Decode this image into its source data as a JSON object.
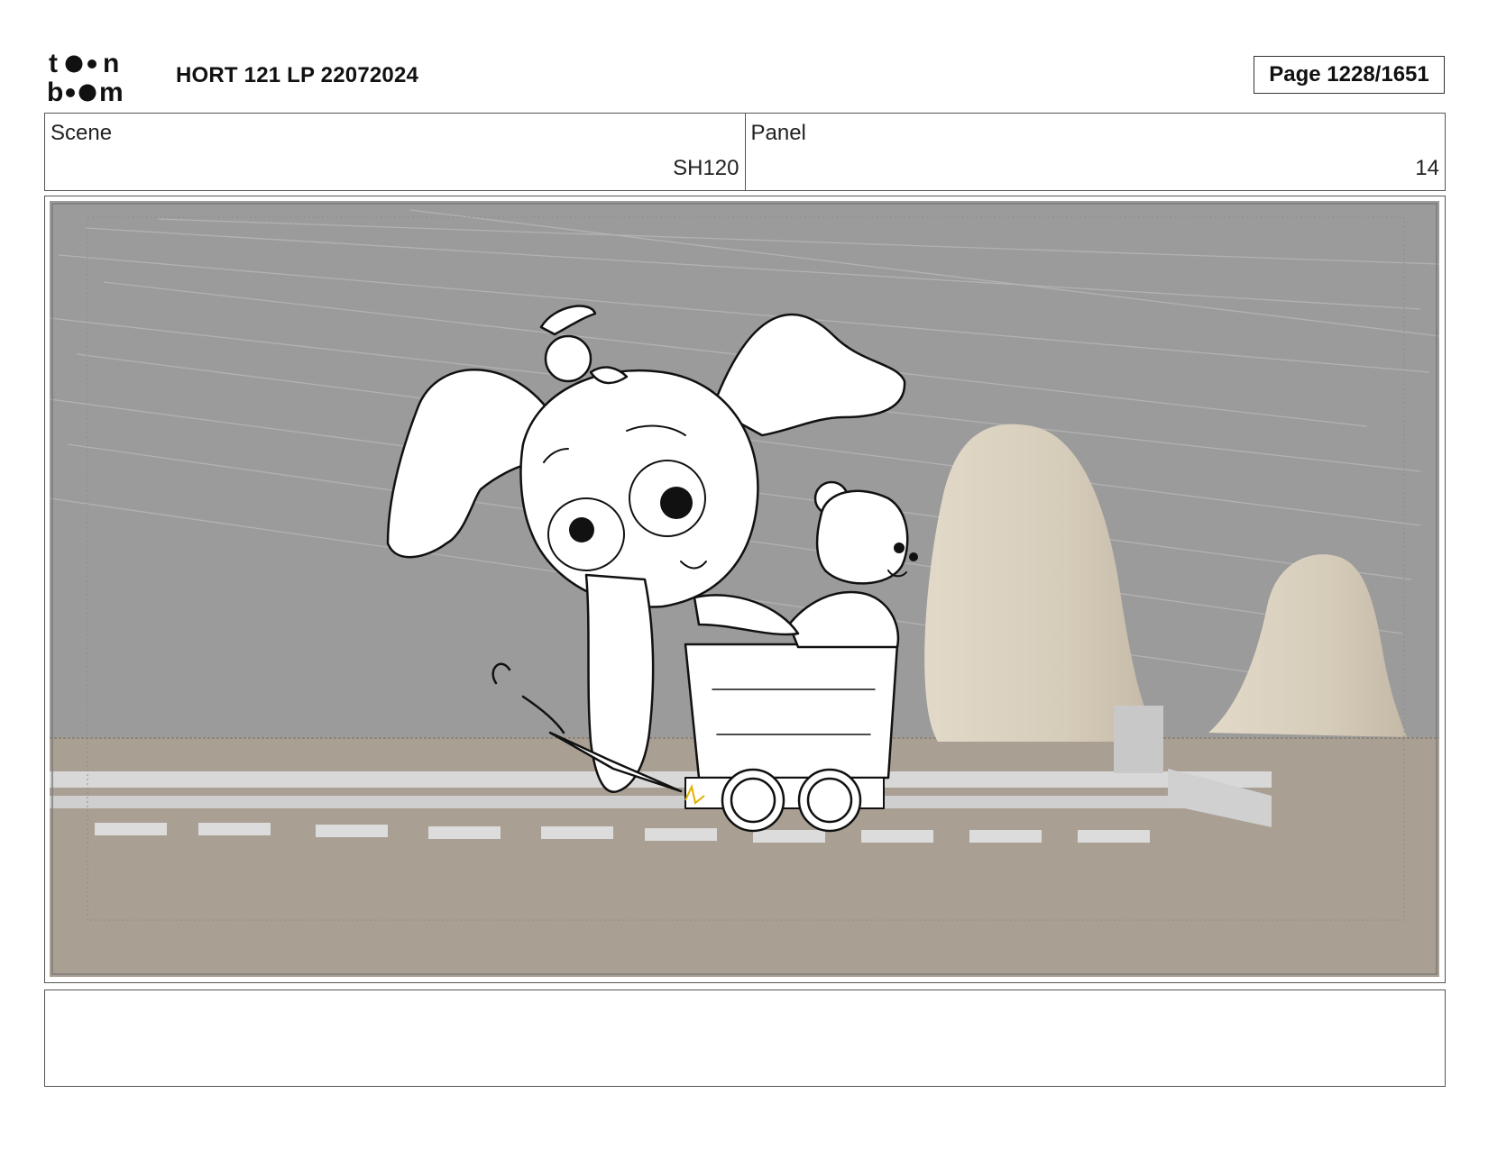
{
  "header": {
    "logo": {
      "name": "toonboom-logo",
      "line1": "to●n",
      "line2": "b●om"
    },
    "title": "HORT 121 LP 22072024",
    "page_label": "Page 1228/1651"
  },
  "scene": {
    "label": "Scene",
    "value": "SH120"
  },
  "panel": {
    "label": "Panel",
    "value": "14"
  },
  "artwork": {
    "description_icon": "storyboard-sketch",
    "colors": {
      "sky": "#9a9a9a",
      "ground": "#a89f92",
      "rock": "#d8cfbf",
      "rail": "#d9d9d9"
    }
  },
  "caption": {
    "text": ""
  }
}
